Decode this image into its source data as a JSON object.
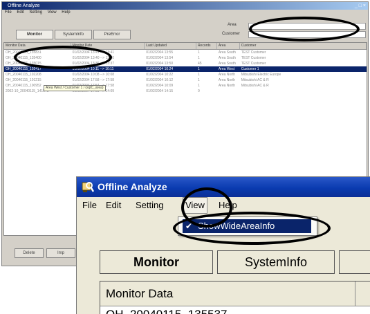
{
  "background_window": {
    "title": "Offline Analyze",
    "window_controls": "_ □ ×",
    "menu": [
      "File",
      "Edit",
      "Setting",
      "View",
      "Help"
    ],
    "filters": {
      "area_label": "Area",
      "customer_label": "Customer"
    },
    "tabs": [
      "Monitor",
      "SystemInfo",
      "PreError"
    ],
    "columns": [
      "Monitor Data",
      "Monitor Date",
      "Last Updated",
      "Records",
      "Area",
      "Customer"
    ],
    "rows": [
      [
        "OH_20040115_135831",
        "01/02/2004 13:41 --> 13:41",
        "01/02/2004 13:55",
        "1",
        "Area South",
        "TEST Customer"
      ],
      [
        "OH_20040115_135400",
        "01/02/2004 13:40 --> 13:40",
        "01/02/2004 13:54",
        "1",
        "Area South",
        "TEST Customer"
      ],
      [
        "OH_20040115_135015",
        "01/02/2004 13:36 --> 13:37",
        "01/02/2004 13:50",
        "45",
        "Area South",
        "TEST Customer"
      ],
      [
        "OH_20040115_102417",
        "01/02/2004 10:11 --> 10:11",
        "01/02/2004 10:24",
        "1",
        "Area West",
        "Customer 1"
      ],
      [
        "OH_20040115_102208",
        "01/02/2004 10:08 --> 10:08",
        "01/02/2004 10:22",
        "1",
        "Area North",
        "Mitsubishi Electric Europe"
      ],
      [
        "OH_20040115_101215",
        "01/02/2004 17:58 --> 17:58",
        "01/02/2004 10:12",
        "1",
        "Area North",
        "Mitsubishi AC & R"
      ],
      [
        "OH_20040115_100952",
        "01/02/2004 17:54 --> 17:58",
        "01/02/2004 10:09",
        "1",
        "Area North",
        "Mitsubishi AC & R"
      ],
      [
        "2002-10_20040115_141548",
        "01/02/2004 14:09 --> 14:09",
        "01/02/2004 14:15",
        "0",
        "",
        ""
      ]
    ],
    "tooltip": "Area West / Customer 1 / (sqlC_area)",
    "buttons": [
      "Delete",
      "Imp"
    ]
  },
  "zoom_window": {
    "title": "Offline Analyze",
    "menu": {
      "file": "File",
      "edit": "Edit",
      "setting": "Setting",
      "view": "View",
      "help": "Help"
    },
    "view_menu_item": {
      "check": "✔",
      "label": "ShowWideAreaInfo"
    },
    "tabs": {
      "monitor": "Monitor",
      "systeminfo": "SystemInfo"
    },
    "table_header": "Monitor Data",
    "first_row_partial": "OH_20040115_135537"
  },
  "colors": {
    "title_bar": "#0a3bb0",
    "selection": "#0a246a",
    "tooltip_bg": "#ffffe1"
  }
}
